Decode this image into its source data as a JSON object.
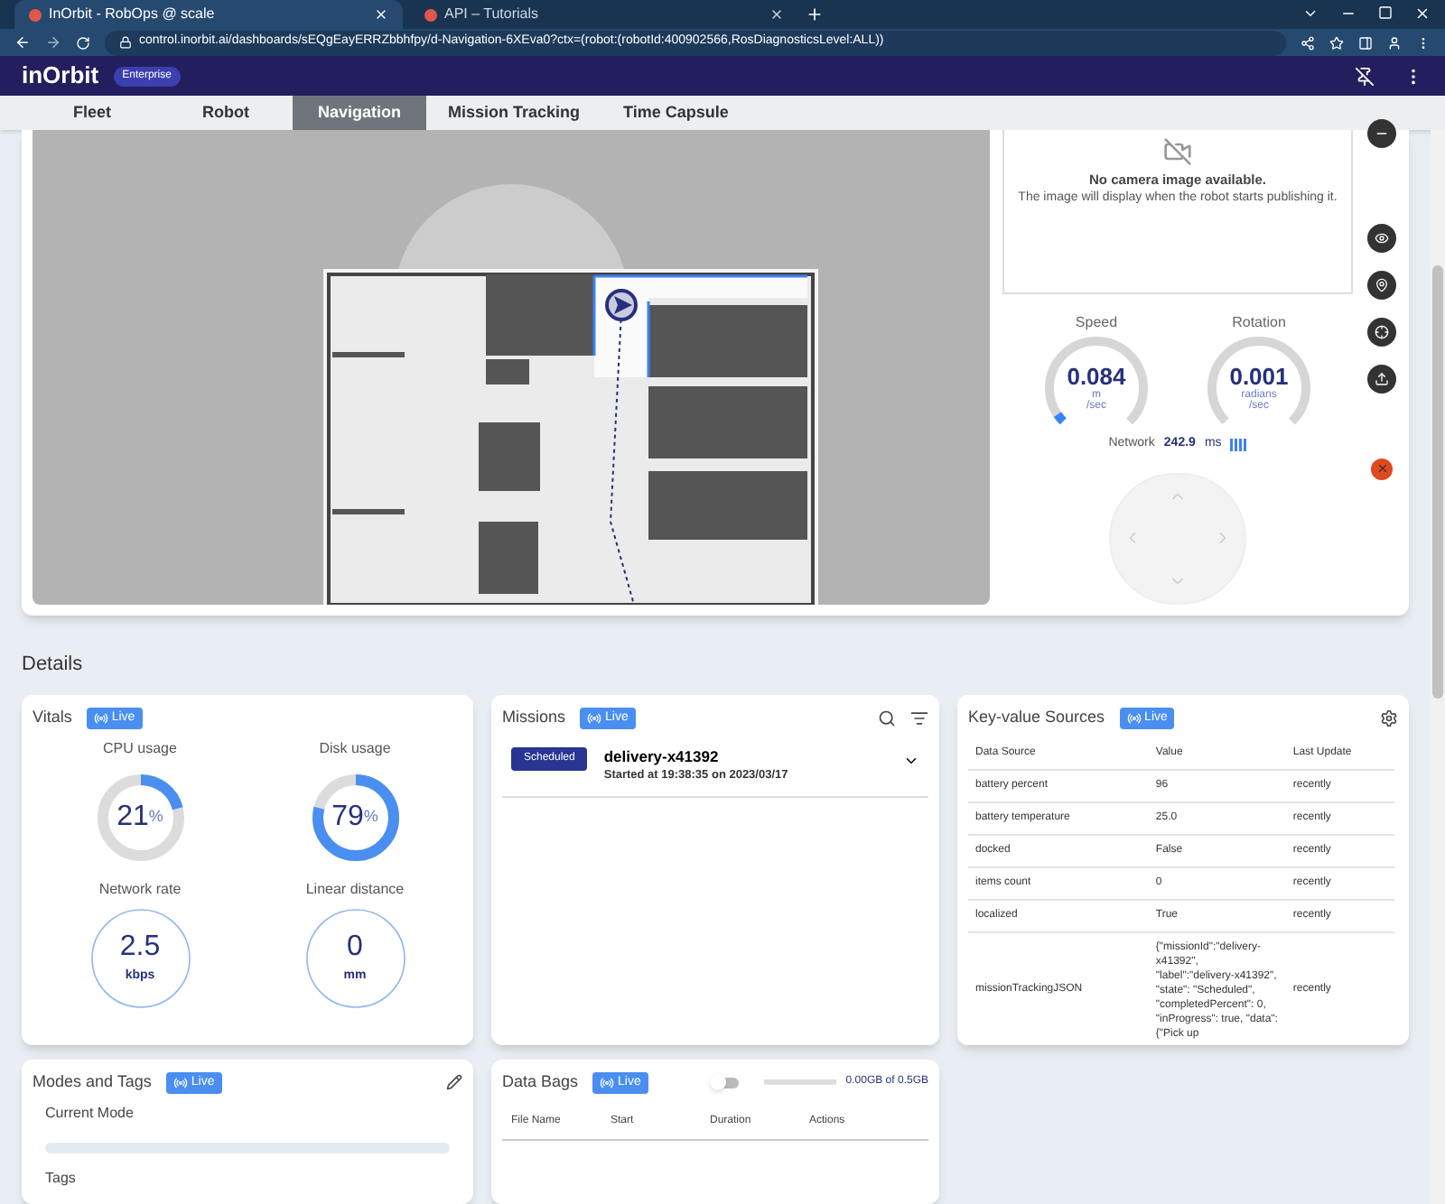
{
  "browser": {
    "tabs": [
      {
        "title": "InOrbit - RobOps @ scale",
        "selected": true
      },
      {
        "title": "API – Tutorials",
        "selected": false
      }
    ],
    "url": "control.inorbit.ai/dashboards/sEQgEayERRZbbhfpy/d-Navigation-6XEva0?ctx=(robot:(robotId:400902566,RosDiagnosticsLevel:ALL))"
  },
  "header": {
    "logo": "inOrbit",
    "edition": "Enterprise"
  },
  "nav_tabs": [
    {
      "label": "Fleet",
      "selected": false
    },
    {
      "label": "Robot",
      "selected": false
    },
    {
      "label": "Navigation",
      "selected": true
    },
    {
      "label": "Mission Tracking",
      "selected": false
    },
    {
      "label": "Time Capsule",
      "selected": false
    }
  ],
  "camera": {
    "title": "No camera image available.",
    "message": "The image will display when the robot starts publishing it."
  },
  "gauges": [
    {
      "label": "Speed",
      "value": "0.084",
      "unit": "m",
      "per": "/sec",
      "level": 0.04
    },
    {
      "label": "Rotation",
      "value": "0.001",
      "unit": "radians",
      "per": "/sec",
      "level": 0
    }
  ],
  "network": {
    "label": "Network",
    "value": "242.9",
    "unit": "ms"
  },
  "details_title": "Details",
  "vitals": {
    "title": "Vitals",
    "live": "Live",
    "items": [
      {
        "kind": "ring",
        "label": "CPU usage",
        "value": "21",
        "unit": "%",
        "level": 0.21
      },
      {
        "kind": "ring",
        "label": "Disk usage",
        "value": "79",
        "unit": "%",
        "level": 0.79
      },
      {
        "kind": "circle",
        "label": "Network rate",
        "value": "2.5",
        "unit": "kbps"
      },
      {
        "kind": "circle",
        "label": "Linear distance",
        "value": "0",
        "unit": "mm"
      }
    ]
  },
  "missions": {
    "title": "Missions",
    "live": "Live",
    "items": [
      {
        "status": "Scheduled",
        "name": "delivery-x41392",
        "started": "Started at 19:38:35 on 2023/03/17"
      }
    ]
  },
  "key_value": {
    "title": "Key-value Sources",
    "live": "Live",
    "columns": [
      "Data Source",
      "Value",
      "Last Update"
    ],
    "rows": [
      [
        "battery percent",
        "96",
        "recently"
      ],
      [
        "battery temperature",
        "25.0",
        "recently"
      ],
      [
        "docked",
        "False",
        "recently"
      ],
      [
        "items count",
        "0",
        "recently"
      ],
      [
        "localized",
        "True",
        "recently"
      ],
      [
        "missionTrackingJSON",
        "{\"missionId\":\"delivery-x41392\", \"label\":\"delivery-x41392\", \"state\": \"Scheduled\", \"completedPercent\": 0, \"inProgress\": true, \"data\": {\"Pick up",
        "recently"
      ]
    ]
  },
  "modes": {
    "title": "Modes and Tags",
    "live": "Live",
    "current_mode": "Current Mode",
    "tags": "Tags"
  },
  "data_bags": {
    "title": "Data Bags",
    "live": "Live",
    "recording": false,
    "storage": "0.00GB of 0.5GB",
    "columns": [
      "File Name",
      "Start",
      "Duration",
      "Actions"
    ]
  }
}
